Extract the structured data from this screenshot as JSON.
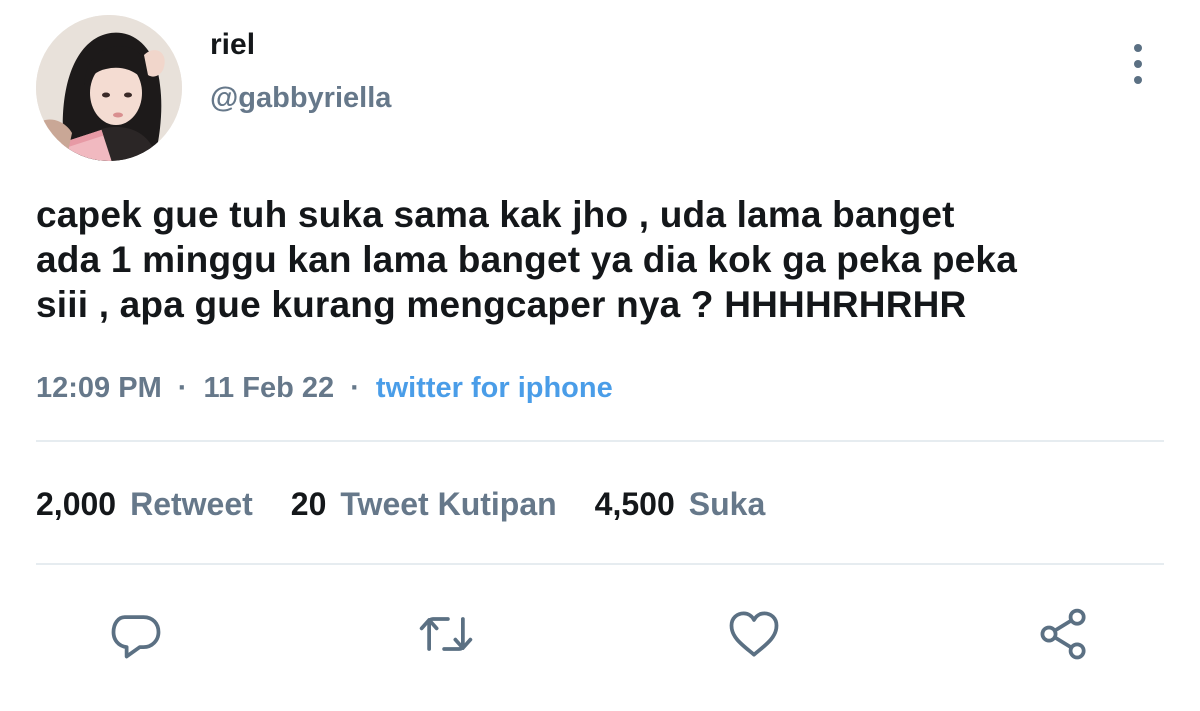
{
  "user": {
    "display_name": "riel",
    "handle": "@gabbyriella",
    "avatar_icon": "profile-photo"
  },
  "tweet": {
    "lines": [
      "capek gue tuh suka sama kak jho , uda lama banget",
      "ada 1 minggu kan lama banget ya dia kok ga peka peka",
      "siii , apa gue kurang mengcaper nya ? HHHHRHRHR"
    ],
    "time": "12:09 PM",
    "date": "11 Feb 22",
    "separator": "·",
    "source": "twitter for iphone"
  },
  "stats": {
    "retweets": {
      "count": "2,000",
      "label": "Retweet"
    },
    "quotes": {
      "count": "20",
      "label": "Tweet Kutipan"
    },
    "likes": {
      "count": "4,500",
      "label": "Suka"
    }
  },
  "actions": [
    {
      "name": "reply",
      "icon": "speech-bubble-icon"
    },
    {
      "name": "retweet",
      "icon": "retweet-arrows-icon"
    },
    {
      "name": "like",
      "icon": "heart-icon"
    },
    {
      "name": "share",
      "icon": "share-nodes-icon"
    }
  ],
  "colors": {
    "text": "#14171a",
    "secondary": "#66788a",
    "link": "#4a9de8",
    "icon": "#5b7083",
    "divider": "#e6ecf0"
  }
}
